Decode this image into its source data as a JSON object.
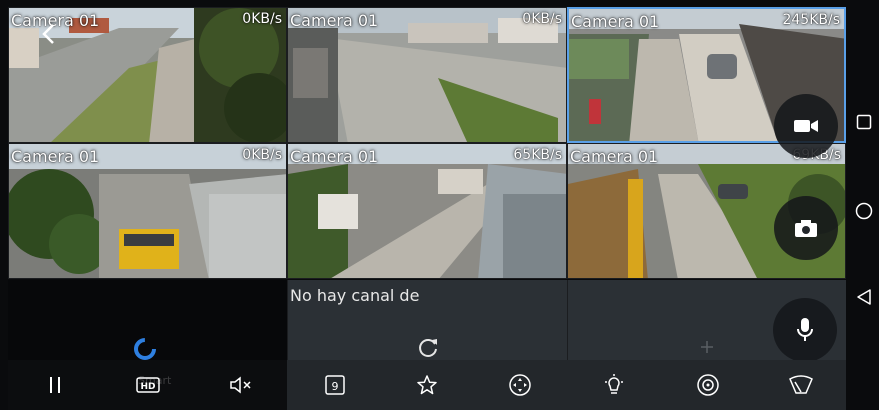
{
  "cameras": [
    {
      "name": "Camera 01",
      "rate": "0KB/s"
    },
    {
      "name": "Camera 01",
      "rate": "0KB/s"
    },
    {
      "name": "Camera 01",
      "rate": "245KB/s"
    },
    {
      "name": "Camera 01",
      "rate": "0KB/s"
    },
    {
      "name": "Camera 01",
      "rate": "65KB/s"
    },
    {
      "name": "Camera 01",
      "rate": "69KB/s"
    }
  ],
  "empty_channel": {
    "message": "No hay canal de"
  },
  "toolbar": {
    "ghost_text": "Smart",
    "icons": [
      "pause-icon",
      "hd-quality-icon",
      "mute-icon",
      "split-screen-icon",
      "favorite-star-icon",
      "ptz-control-icon",
      "light-icon",
      "alarm-icon",
      "wiper-icon"
    ]
  },
  "side_buttons": [
    "record-video-icon",
    "snapshot-camera-icon",
    "microphone-icon"
  ],
  "system_nav": [
    "recent-apps-icon",
    "home-icon",
    "back-icon"
  ],
  "colors": {
    "selected_border": "#5aa0e8",
    "accent_blue": "#2e7fe0",
    "toolbar_bg": "#23272b",
    "empty_panel_bg": "#2b3035"
  }
}
